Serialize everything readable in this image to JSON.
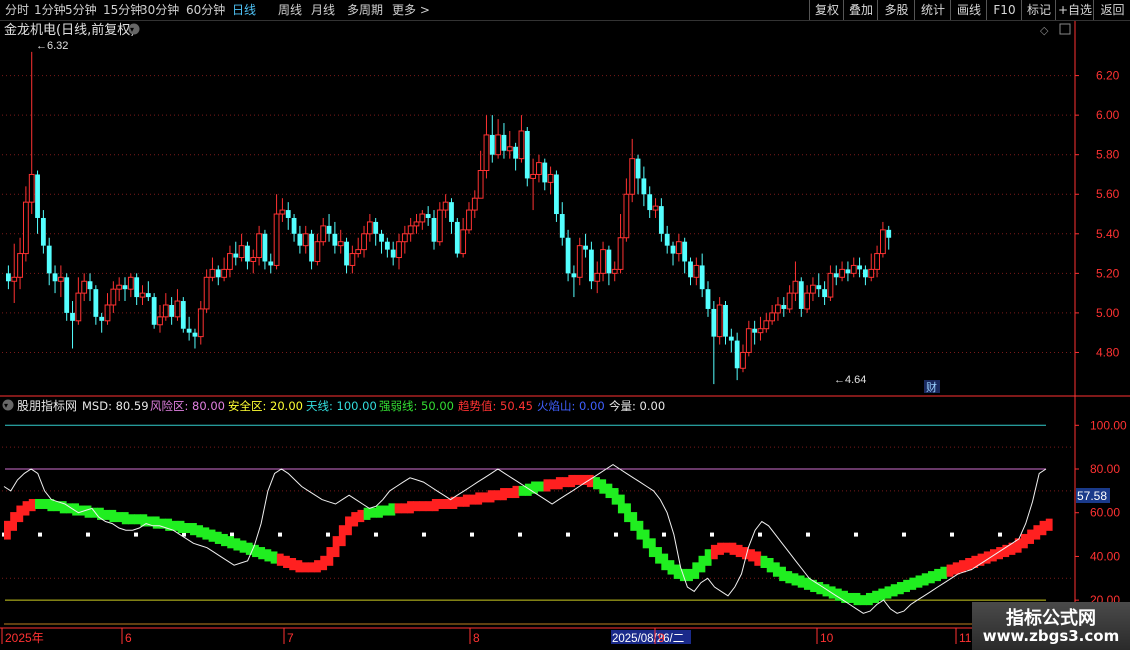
{
  "toolbar": {
    "periods": [
      "分时",
      "1分钟",
      "5分钟",
      "15分钟",
      "30分钟",
      "60分钟",
      "日线",
      "周线",
      "月线",
      "多周期",
      "更多 >"
    ],
    "active_period": "日线",
    "right_buttons": [
      "复权",
      "叠加",
      "多股",
      "统计",
      "画线",
      "F10",
      "标记",
      "+自选",
      "返回"
    ]
  },
  "main_chart": {
    "title": "金龙机电(日线,前复权)",
    "price_axis": [
      "6.20",
      "6.00",
      "5.80",
      "5.60",
      "5.40",
      "5.20",
      "5.00",
      "4.80"
    ],
    "price_range": [
      4.6,
      6.38
    ],
    "high_label": "6.32",
    "low_label": "4.64",
    "badge": "财"
  },
  "indicator": {
    "name": "股朋指标网",
    "values": [
      {
        "label": "MSD: 80.59",
        "color": "#e8e8e8"
      },
      {
        "label": "风险区: 80.00",
        "color": "#e080e0"
      },
      {
        "label": "安全区: 20.00",
        "color": "#ffff33"
      },
      {
        "label": "天线: 100.00",
        "color": "#33dddd"
      },
      {
        "label": "强弱线: 50.00",
        "color": "#33dd33"
      },
      {
        "label": "趋势值: 50.45",
        "color": "#ff3333"
      },
      {
        "label": "火焰山: 0.00",
        "color": "#4060ff"
      },
      {
        "label": "今量: 0.00",
        "color": "#e8e8e8"
      }
    ],
    "axis": [
      "100.00",
      "80.00",
      "60.00",
      "40.00",
      "20.00"
    ],
    "axis_range": [
      10,
      107
    ],
    "current_value": "57.58",
    "levels": {
      "sky": 100,
      "risk": 80,
      "midline": 50,
      "safe": 20
    }
  },
  "date_axis": {
    "labels": [
      "2025年",
      "6",
      "7",
      "8",
      "2025/08/26/二",
      "9",
      "10",
      "11"
    ]
  },
  "watermark": {
    "line1": "指标公式网",
    "line2": "www.zbgs3.com"
  },
  "colors": {
    "up": "#ff3232",
    "down": "#54ffff",
    "bg": "#000000",
    "axis": "#ff3232",
    "grid": "#7a1a1a",
    "active_tab": "#4fc3f7"
  },
  "chart_data": {
    "type": "candlestick",
    "candles": [
      [
        5.2,
        5.16,
        5.24,
        5.12
      ],
      [
        5.16,
        5.18,
        5.35,
        5.05
      ],
      [
        5.18,
        5.3,
        5.38,
        5.12
      ],
      [
        5.3,
        5.56,
        5.64,
        5.26
      ],
      [
        5.56,
        5.7,
        6.32,
        5.5
      ],
      [
        5.7,
        5.48,
        5.72,
        5.4
      ],
      [
        5.48,
        5.34,
        5.52,
        5.3
      ],
      [
        5.34,
        5.2,
        5.38,
        5.14
      ],
      [
        5.2,
        5.16,
        5.24,
        5.1
      ],
      [
        5.16,
        5.18,
        5.24,
        5.08
      ],
      [
        5.18,
        5.0,
        5.2,
        4.96
      ],
      [
        5.0,
        4.96,
        5.06,
        4.82
      ],
      [
        4.96,
        5.1,
        5.18,
        4.94
      ],
      [
        5.1,
        5.16,
        5.2,
        5.06
      ],
      [
        5.16,
        5.12,
        5.2,
        5.06
      ],
      [
        5.12,
        4.98,
        5.14,
        4.94
      ],
      [
        4.98,
        4.96,
        5.0,
        4.9
      ],
      [
        4.96,
        5.04,
        5.1,
        4.94
      ],
      [
        5.04,
        5.12,
        5.16,
        5.0
      ],
      [
        5.12,
        5.14,
        5.18,
        5.06
      ],
      [
        5.14,
        5.12,
        5.18,
        5.06
      ],
      [
        5.12,
        5.18,
        5.2,
        5.08
      ],
      [
        5.18,
        5.08,
        5.2,
        5.04
      ],
      [
        5.08,
        5.1,
        5.14,
        5.04
      ],
      [
        5.1,
        5.08,
        5.16,
        5.06
      ],
      [
        5.08,
        4.94,
        5.1,
        4.92
      ],
      [
        4.94,
        4.98,
        5.04,
        4.9
      ],
      [
        4.98,
        5.04,
        5.1,
        4.96
      ],
      [
        5.04,
        4.98,
        5.08,
        4.94
      ],
      [
        4.98,
        5.06,
        5.12,
        4.96
      ],
      [
        5.06,
        4.92,
        5.08,
        4.9
      ],
      [
        4.92,
        4.9,
        4.98,
        4.86
      ],
      [
        4.9,
        4.88,
        4.92,
        4.82
      ],
      [
        4.88,
        5.02,
        5.06,
        4.84
      ],
      [
        5.02,
        5.18,
        5.22,
        5.0
      ],
      [
        5.18,
        5.22,
        5.28,
        5.16
      ],
      [
        5.22,
        5.18,
        5.24,
        5.14
      ],
      [
        5.18,
        5.22,
        5.28,
        5.16
      ],
      [
        5.22,
        5.3,
        5.34,
        5.18
      ],
      [
        5.3,
        5.28,
        5.36,
        5.24
      ],
      [
        5.28,
        5.34,
        5.4,
        5.26
      ],
      [
        5.34,
        5.26,
        5.36,
        5.22
      ],
      [
        5.26,
        5.28,
        5.32,
        5.2
      ],
      [
        5.28,
        5.4,
        5.44,
        5.24
      ],
      [
        5.4,
        5.26,
        5.42,
        5.22
      ],
      [
        5.26,
        5.24,
        5.3,
        5.2
      ],
      [
        5.24,
        5.5,
        5.6,
        5.22
      ],
      [
        5.5,
        5.52,
        5.58,
        5.46
      ],
      [
        5.52,
        5.48,
        5.56,
        5.42
      ],
      [
        5.48,
        5.4,
        5.5,
        5.36
      ],
      [
        5.4,
        5.34,
        5.44,
        5.3
      ],
      [
        5.34,
        5.4,
        5.44,
        5.3
      ],
      [
        5.4,
        5.26,
        5.42,
        5.22
      ],
      [
        5.26,
        5.36,
        5.4,
        5.24
      ],
      [
        5.36,
        5.44,
        5.48,
        5.34
      ],
      [
        5.44,
        5.4,
        5.5,
        5.36
      ],
      [
        5.4,
        5.34,
        5.46,
        5.3
      ],
      [
        5.34,
        5.36,
        5.42,
        5.3
      ],
      [
        5.36,
        5.24,
        5.38,
        5.2
      ],
      [
        5.24,
        5.3,
        5.34,
        5.2
      ],
      [
        5.3,
        5.32,
        5.38,
        5.28
      ],
      [
        5.32,
        5.4,
        5.44,
        5.28
      ],
      [
        5.4,
        5.46,
        5.5,
        5.36
      ],
      [
        5.46,
        5.4,
        5.48,
        5.34
      ],
      [
        5.4,
        5.36,
        5.42,
        5.3
      ],
      [
        5.36,
        5.32,
        5.38,
        5.28
      ],
      [
        5.32,
        5.28,
        5.36,
        5.24
      ],
      [
        5.28,
        5.36,
        5.4,
        5.22
      ],
      [
        5.36,
        5.4,
        5.44,
        5.3
      ],
      [
        5.4,
        5.44,
        5.48,
        5.36
      ],
      [
        5.44,
        5.46,
        5.5,
        5.4
      ],
      [
        5.46,
        5.5,
        5.52,
        5.42
      ],
      [
        5.5,
        5.48,
        5.54,
        5.44
      ],
      [
        5.48,
        5.36,
        5.52,
        5.32
      ],
      [
        5.36,
        5.52,
        5.56,
        5.34
      ],
      [
        5.52,
        5.56,
        5.6,
        5.48
      ],
      [
        5.56,
        5.46,
        5.58,
        5.4
      ],
      [
        5.46,
        5.3,
        5.48,
        5.28
      ],
      [
        5.3,
        5.42,
        5.48,
        5.28
      ],
      [
        5.42,
        5.52,
        5.56,
        5.4
      ],
      [
        5.52,
        5.58,
        5.62,
        5.48
      ],
      [
        5.58,
        5.72,
        5.82,
        5.64
      ],
      [
        5.72,
        5.9,
        6.0,
        5.68
      ],
      [
        5.9,
        5.8,
        6.0,
        5.76
      ],
      [
        5.8,
        5.9,
        5.98,
        5.78
      ],
      [
        5.9,
        5.82,
        5.96,
        5.78
      ],
      [
        5.82,
        5.84,
        5.92,
        5.78
      ],
      [
        5.84,
        5.78,
        5.86,
        5.72
      ],
      [
        5.78,
        5.92,
        6.0,
        5.76
      ],
      [
        5.92,
        5.68,
        5.94,
        5.64
      ],
      [
        5.68,
        5.7,
        5.78,
        5.52
      ],
      [
        5.7,
        5.76,
        5.8,
        5.66
      ],
      [
        5.76,
        5.66,
        5.78,
        5.62
      ],
      [
        5.66,
        5.7,
        5.74,
        5.6
      ],
      [
        5.7,
        5.5,
        5.72,
        5.46
      ],
      [
        5.5,
        5.38,
        5.56,
        5.34
      ],
      [
        5.38,
        5.2,
        5.42,
        5.16
      ],
      [
        5.2,
        5.18,
        5.24,
        5.08
      ],
      [
        5.18,
        5.34,
        5.38,
        5.14
      ],
      [
        5.34,
        5.32,
        5.4,
        5.28
      ],
      [
        5.32,
        5.16,
        5.36,
        5.12
      ],
      [
        5.16,
        5.2,
        5.26,
        5.1
      ],
      [
        5.2,
        5.32,
        5.36,
        5.16
      ],
      [
        5.32,
        5.2,
        5.34,
        5.14
      ],
      [
        5.2,
        5.22,
        5.26,
        5.16
      ],
      [
        5.22,
        5.38,
        5.5,
        5.2
      ],
      [
        5.38,
        5.6,
        5.68,
        5.36
      ],
      [
        5.6,
        5.78,
        5.88,
        5.56
      ],
      [
        5.78,
        5.68,
        5.8,
        5.6
      ],
      [
        5.68,
        5.6,
        5.74,
        5.54
      ],
      [
        5.6,
        5.52,
        5.64,
        5.48
      ],
      [
        5.52,
        5.54,
        5.58,
        5.48
      ],
      [
        5.54,
        5.4,
        5.58,
        5.36
      ],
      [
        5.4,
        5.34,
        5.44,
        5.3
      ],
      [
        5.34,
        5.3,
        5.36,
        5.24
      ],
      [
        5.3,
        5.36,
        5.4,
        5.26
      ],
      [
        5.36,
        5.26,
        5.38,
        5.2
      ],
      [
        5.26,
        5.18,
        5.28,
        5.14
      ],
      [
        5.18,
        5.24,
        5.28,
        5.14
      ],
      [
        5.24,
        5.12,
        5.3,
        5.08
      ],
      [
        5.12,
        5.02,
        5.16,
        4.98
      ],
      [
        5.02,
        4.88,
        5.06,
        4.64
      ],
      [
        4.88,
        5.04,
        5.08,
        4.84
      ],
      [
        5.04,
        4.88,
        5.06,
        4.84
      ],
      [
        4.88,
        4.86,
        4.92,
        4.8
      ],
      [
        4.86,
        4.72,
        4.9,
        4.66
      ],
      [
        4.72,
        4.8,
        4.84,
        4.7
      ],
      [
        4.8,
        4.92,
        4.96,
        4.78
      ],
      [
        4.92,
        4.9,
        4.96,
        4.84
      ],
      [
        4.9,
        4.92,
        4.98,
        4.86
      ],
      [
        4.92,
        4.96,
        5.0,
        4.9
      ],
      [
        4.96,
        5.0,
        5.04,
        4.94
      ],
      [
        5.0,
        5.04,
        5.08,
        4.96
      ],
      [
        5.04,
        5.02,
        5.08,
        4.98
      ],
      [
        5.02,
        5.1,
        5.14,
        5.0
      ],
      [
        5.1,
        5.16,
        5.26,
        5.06
      ],
      [
        5.16,
        5.02,
        5.18,
        4.98
      ],
      [
        5.02,
        5.1,
        5.14,
        5.0
      ],
      [
        5.1,
        5.14,
        5.18,
        5.06
      ],
      [
        5.14,
        5.12,
        5.2,
        5.08
      ],
      [
        5.12,
        5.08,
        5.16,
        5.04
      ],
      [
        5.08,
        5.2,
        5.24,
        5.06
      ],
      [
        5.2,
        5.18,
        5.24,
        5.14
      ],
      [
        5.18,
        5.22,
        5.26,
        5.16
      ],
      [
        5.22,
        5.2,
        5.26,
        5.16
      ],
      [
        5.2,
        5.24,
        5.28,
        5.18
      ],
      [
        5.24,
        5.22,
        5.28,
        5.18
      ],
      [
        5.22,
        5.18,
        5.24,
        5.14
      ],
      [
        5.18,
        5.22,
        5.3,
        5.16
      ],
      [
        5.22,
        5.3,
        5.34,
        5.18
      ],
      [
        5.3,
        5.42,
        5.46,
        5.28
      ],
      [
        5.42,
        5.38,
        5.44,
        5.32
      ]
    ],
    "msd_line": [
      72,
      70,
      75,
      78,
      80,
      78,
      70,
      66,
      65,
      64,
      62,
      60,
      61,
      62,
      58,
      56,
      55,
      53,
      52,
      52,
      53,
      55,
      54,
      54,
      53,
      52,
      50,
      48,
      46,
      45,
      44,
      42,
      40,
      38,
      36,
      37,
      38,
      45,
      55,
      70,
      78,
      80,
      78,
      75,
      72,
      70,
      68,
      66,
      65,
      64,
      66,
      68,
      66,
      64,
      62,
      63,
      66,
      70,
      72,
      74,
      76,
      75,
      74,
      72,
      70,
      68,
      66,
      68,
      70,
      72,
      74,
      76,
      78,
      80,
      78,
      76,
      74,
      72,
      70,
      68,
      66,
      64,
      66,
      68,
      70,
      72,
      74,
      76,
      78,
      80,
      82,
      80,
      78,
      76,
      74,
      72,
      70,
      66,
      60,
      50,
      35,
      26,
      24,
      28,
      30,
      26,
      24,
      22,
      26,
      32,
      44,
      52,
      56,
      54,
      50,
      46,
      42,
      38,
      34,
      30,
      28,
      26,
      24,
      22,
      20,
      18,
      16,
      14,
      15,
      18,
      20,
      16,
      14,
      15,
      18,
      20,
      22,
      24,
      26,
      28,
      30,
      32,
      33,
      34,
      36,
      38,
      40,
      42,
      44,
      46,
      48,
      55,
      65,
      78,
      80
    ],
    "trend_line": [
      50,
      54,
      58,
      61,
      63,
      64,
      64,
      64,
      63,
      63,
      62,
      62,
      61,
      61,
      60,
      60,
      59,
      59,
      58,
      58,
      57,
      57,
      57,
      56,
      56,
      55,
      55,
      54,
      54,
      53,
      53,
      52,
      51,
      50,
      49,
      48,
      47,
      46,
      45,
      44,
      43,
      42,
      41,
      40,
      39,
      38,
      37,
      36,
      35,
      35,
      35,
      36,
      38,
      42,
      47,
      52,
      56,
      58,
      59,
      60,
      60,
      61,
      61,
      62,
      62,
      62,
      63,
      63,
      63,
      63,
      64,
      64,
      64,
      65,
      65,
      66,
      66,
      67,
      67,
      68,
      68,
      69,
      69,
      70,
      70,
      71,
      72,
      72,
      73,
      73,
      74,
      74,
      75,
      75,
      75,
      74,
      73,
      71,
      69,
      66,
      62,
      58,
      54,
      50,
      46,
      42,
      39,
      36,
      34,
      32,
      31,
      32,
      35,
      38,
      41,
      43,
      44,
      44,
      43,
      42,
      41,
      40,
      38,
      37,
      35,
      33,
      31,
      30,
      29,
      28,
      27,
      26,
      25,
      24,
      23,
      22,
      21,
      21,
      20,
      20,
      21,
      22,
      23,
      24,
      25,
      26,
      27,
      28,
      29,
      30,
      31,
      32,
      33,
      34,
      35,
      36,
      37,
      38,
      39,
      40,
      41,
      42,
      43,
      44,
      46,
      48,
      50,
      52,
      54,
      55
    ],
    "trend_colors": "rrrrrrgggggggggggggggggggggggggggggggggggggggrrrrrrrrrrrrrrgggggrrrrrrrrrrrrrrrrrrrrggggrrrrrrrrgggggggggggggggggggrrrrrrrrggggggggggggggggggggggggggggggrrrrrrrrrrrrrrrrrrrrrrrrrrrrrrrr"
  }
}
